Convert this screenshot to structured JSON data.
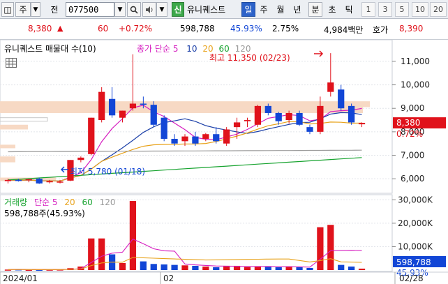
{
  "toolbar": {
    "type_label": "주",
    "tab_jeon": "전",
    "stock_code": "077500",
    "badge_sin": "신",
    "stock_name": "유니퀘스트",
    "periods": [
      "일",
      "주",
      "월",
      "년",
      "분",
      "초",
      "틱"
    ],
    "selected_period": "일",
    "intervals": [
      "1",
      "3",
      "5",
      "10",
      "20"
    ]
  },
  "quote": {
    "price": "8,380",
    "change": "60",
    "change_pct": "+0.72%",
    "volume": "598,788",
    "pct2": "45.93%",
    "pct3": "2.75%",
    "amount": "4,984백만",
    "bid_label": "호가",
    "bid_price": "8,390"
  },
  "price_panel": {
    "legend_title": "유니퀘스트 매물대 수(10)",
    "ma_label": "종가 단순",
    "ma_periods": [
      "5",
      "10",
      "20",
      "60",
      "120"
    ],
    "high_label": "최고 11,350 (02/23)",
    "low_label": "최저 5,780 (01/18)",
    "y_ticks": [
      "11,000",
      "10,000",
      "9,000",
      "8,000",
      "7,000",
      "6,000"
    ],
    "current_price_tag": "8,380",
    "current_pct_tag": "0.72%"
  },
  "volume_panel": {
    "legend_title": "거래량",
    "ma_label": "단순",
    "ma_periods": [
      "5",
      "20",
      "60",
      "120"
    ],
    "info": "598,788주(45.93%)",
    "y_ticks": [
      "30,000K",
      "20,000K",
      "10,000K"
    ],
    "current_tag": "598,788",
    "current_pct": "45.93%"
  },
  "x_axis": {
    "labels": [
      "2024/01",
      "02",
      "02/28"
    ]
  },
  "colors": {
    "up": "#e0121b",
    "down": "#1246d6",
    "ma5": "#d61fc0",
    "ma10": "#1b3fa8",
    "ma20": "#e8a21a",
    "ma60": "#17a32f",
    "ma120": "#9a9a9a"
  },
  "chart_data": {
    "type": "candlestick",
    "ylim": [
      5500,
      11800
    ],
    "candles": [
      {
        "o": 5900,
        "h": 6000,
        "l": 5800,
        "c": 5950
      },
      {
        "o": 5950,
        "h": 6000,
        "l": 5880,
        "c": 5920
      },
      {
        "o": 5950,
        "h": 6000,
        "l": 5850,
        "c": 5980
      },
      {
        "o": 6000,
        "h": 6050,
        "l": 5780,
        "c": 5800
      },
      {
        "o": 5850,
        "h": 5950,
        "l": 5800,
        "c": 5900
      },
      {
        "o": 5850,
        "h": 5950,
        "l": 5800,
        "c": 5880
      },
      {
        "o": 5920,
        "h": 6800,
        "l": 5900,
        "c": 6800
      },
      {
        "o": 6800,
        "h": 6950,
        "l": 6700,
        "c": 6900
      },
      {
        "o": 7050,
        "h": 8600,
        "l": 7000,
        "c": 8600
      },
      {
        "o": 8500,
        "h": 9900,
        "l": 8400,
        "c": 9700
      },
      {
        "o": 9400,
        "h": 9900,
        "l": 8600,
        "c": 8700
      },
      {
        "o": 8600,
        "h": 8900,
        "l": 8400,
        "c": 8900
      },
      {
        "o": 9000,
        "h": 11300,
        "l": 8900,
        "c": 9200
      },
      {
        "o": 9200,
        "h": 9500,
        "l": 9000,
        "c": 9150
      },
      {
        "o": 9150,
        "h": 9300,
        "l": 8200,
        "c": 8300
      },
      {
        "o": 8600,
        "h": 8700,
        "l": 7600,
        "c": 7700
      },
      {
        "o": 7700,
        "h": 7900,
        "l": 7400,
        "c": 7500
      },
      {
        "o": 7600,
        "h": 7900,
        "l": 7400,
        "c": 7800
      },
      {
        "o": 7800,
        "h": 8000,
        "l": 7400,
        "c": 7500
      },
      {
        "o": 7700,
        "h": 7950,
        "l": 7600,
        "c": 7900
      },
      {
        "o": 7900,
        "h": 8200,
        "l": 7500,
        "c": 7600
      },
      {
        "o": 7500,
        "h": 8200,
        "l": 7400,
        "c": 8100
      },
      {
        "o": 8200,
        "h": 8600,
        "l": 7700,
        "c": 8400
      },
      {
        "o": 8450,
        "h": 8600,
        "l": 8200,
        "c": 8500
      },
      {
        "o": 8300,
        "h": 9150,
        "l": 8200,
        "c": 9100
      },
      {
        "o": 9100,
        "h": 9200,
        "l": 8700,
        "c": 8800
      },
      {
        "o": 8800,
        "h": 8850,
        "l": 8300,
        "c": 8450
      },
      {
        "o": 8500,
        "h": 8900,
        "l": 8350,
        "c": 8800
      },
      {
        "o": 8800,
        "h": 8900,
        "l": 8250,
        "c": 8300
      },
      {
        "o": 8200,
        "h": 8300,
        "l": 7900,
        "c": 8000
      },
      {
        "o": 8000,
        "h": 9500,
        "l": 7900,
        "c": 9100
      },
      {
        "o": 9700,
        "h": 11350,
        "l": 9500,
        "c": 10100
      },
      {
        "o": 9800,
        "h": 10000,
        "l": 8900,
        "c": 9000
      },
      {
        "o": 9100,
        "h": 9200,
        "l": 8300,
        "c": 8400
      },
      {
        "o": 8320,
        "h": 8400,
        "l": 8200,
        "c": 8380
      }
    ],
    "volumes": [
      200,
      300,
      150,
      150,
      200,
      250,
      800,
      1500,
      13500,
      13500,
      6700,
      3000,
      29500,
      3700,
      2600,
      2400,
      2200,
      2000,
      1800,
      1500,
      1200,
      1800,
      1800,
      1300,
      1500,
      1400,
      1200,
      1600,
      1200,
      900,
      18300,
      19300,
      2200,
      1500,
      599
    ],
    "volume_ylim": [
      0,
      31000
    ]
  }
}
